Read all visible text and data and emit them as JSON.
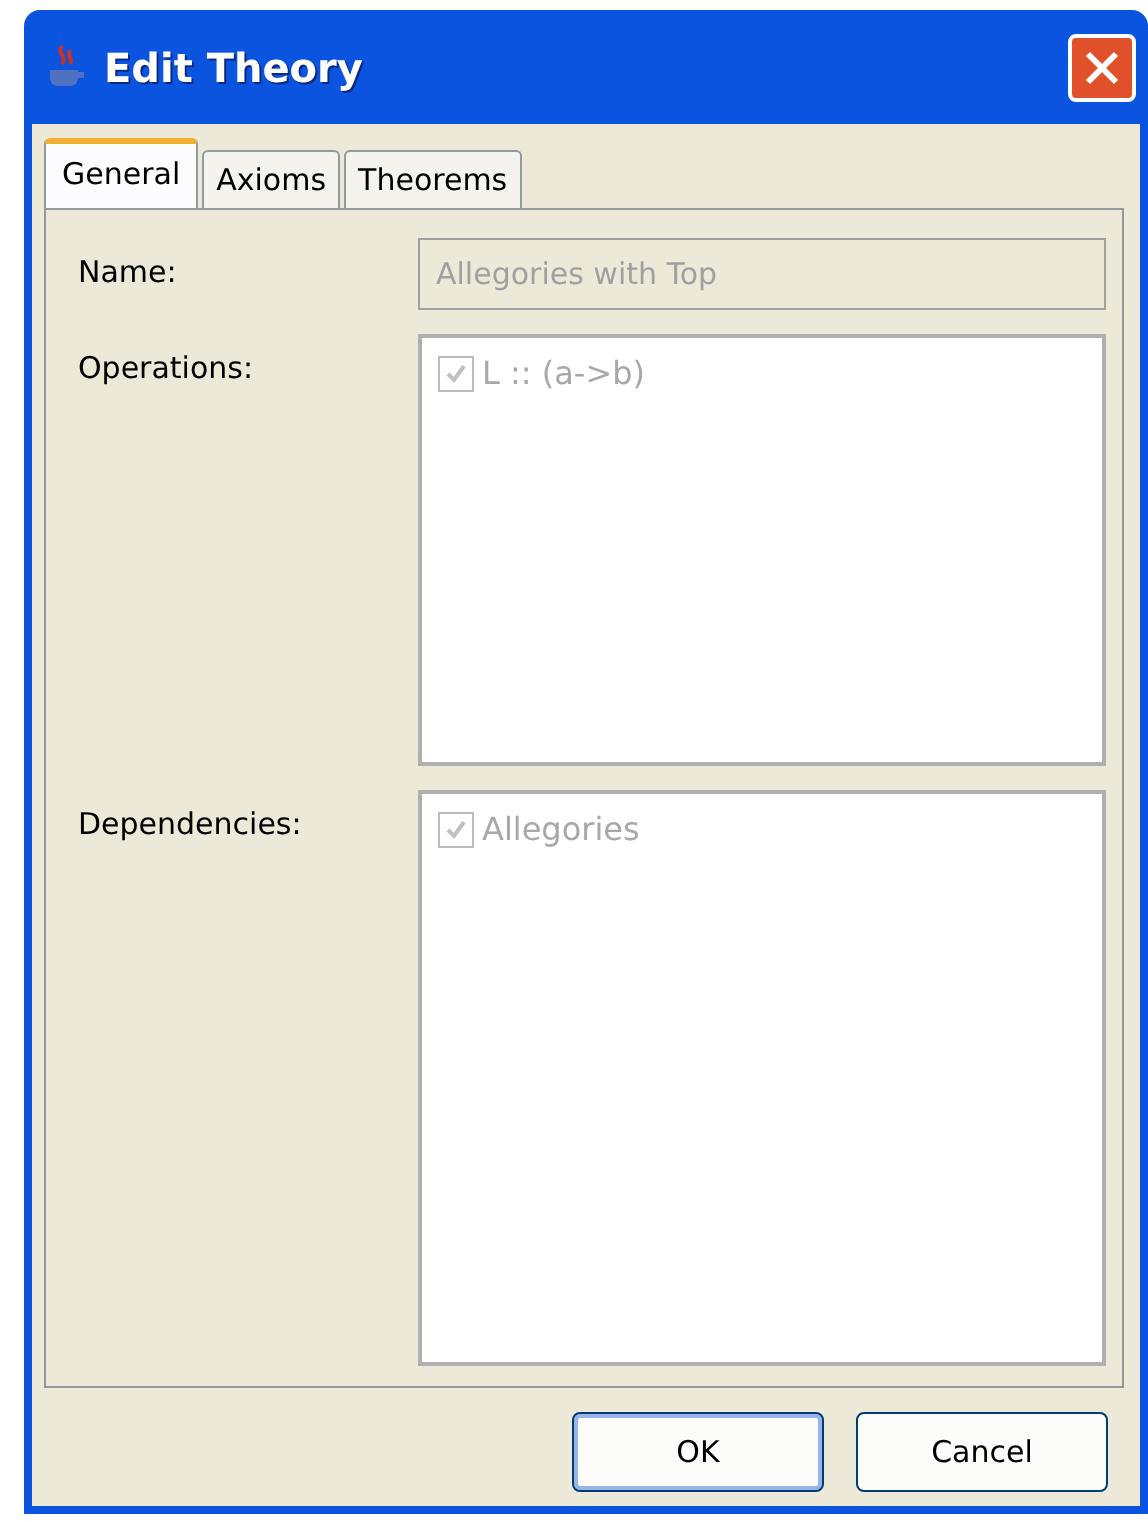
{
  "window": {
    "title": "Edit Theory"
  },
  "tabs": [
    {
      "label": "General",
      "selected": true
    },
    {
      "label": "Axioms",
      "selected": false
    },
    {
      "label": "Theorems",
      "selected": false
    }
  ],
  "name_field": {
    "label": "Name:",
    "value": "Allegories with Top",
    "disabled": true
  },
  "operations": {
    "label": "Operations:",
    "items": [
      {
        "text": "L :: (a->b)",
        "checked": true,
        "disabled": true
      }
    ]
  },
  "dependencies": {
    "label": "Dependencies:",
    "items": [
      {
        "text": "Allegories",
        "checked": true,
        "disabled": true
      }
    ]
  },
  "buttons": [
    {
      "label": "OK",
      "default": true
    },
    {
      "label": "Cancel",
      "default": false
    }
  ]
}
